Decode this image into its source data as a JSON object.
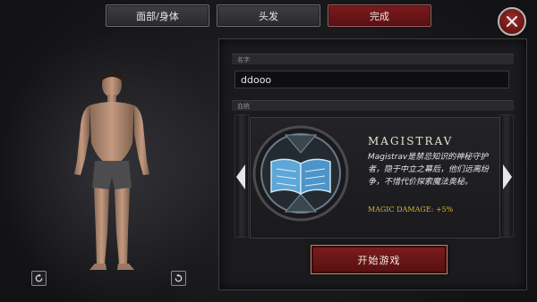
{
  "tabs": [
    {
      "label": "面部/身体",
      "active": false
    },
    {
      "label": "头发",
      "active": false
    },
    {
      "label": "完成",
      "active": true
    }
  ],
  "name_section": {
    "label": "名字",
    "value": "ddooo"
  },
  "background_section": {
    "label": "血统",
    "title": "MAGISTRAV",
    "description": "Magistrav是禁忌知识的神秘守护者，隐于中立之幕后，他们远离纷争，不惜代价探索魔法奥秘。",
    "bonus": "MAGIC DAMAGE: +5%"
  },
  "start_button": {
    "label": "开始游戏"
  },
  "colors": {
    "accent": "#6b1416",
    "bonus": "#d1b33a"
  },
  "icons": [
    "close-icon",
    "rotate-left-icon",
    "rotate-right-icon",
    "arrow-left-icon",
    "arrow-right-icon",
    "book-emblem-icon"
  ]
}
